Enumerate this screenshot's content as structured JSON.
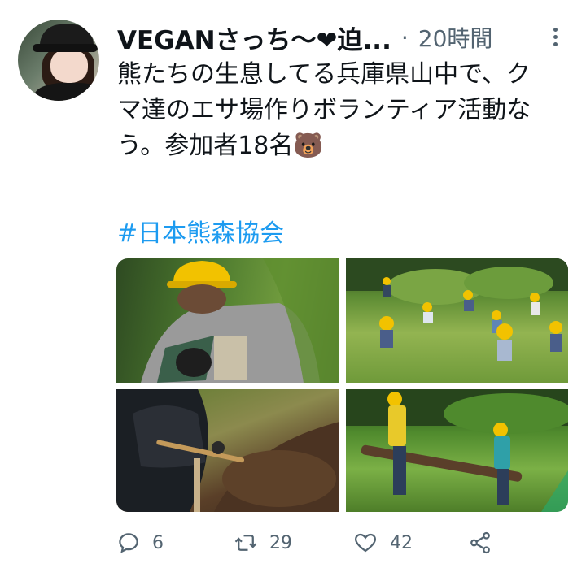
{
  "tweet": {
    "display_name": "VEGANさっち〜❤迫...",
    "separator": "·",
    "time": "20時間",
    "text": "熊たちの生息してる兵庫県山中で、クマ達のエサ場作りボランティア活動なう。参加者18名",
    "bear_emoji": "🐻",
    "hashtag": "#日本熊森協会"
  },
  "media": [
    {
      "icon": "photo-volunteer-back-hardhat"
    },
    {
      "icon": "photo-volunteers-field"
    },
    {
      "icon": "photo-digging-soil"
    },
    {
      "icon": "photo-carrying-log"
    }
  ],
  "actions": {
    "reply_count": "6",
    "retweet_count": "29",
    "like_count": "42"
  },
  "colors": {
    "link": "#1d9bf0",
    "secondary_text": "#536471",
    "hardhat": "#f2c200"
  }
}
